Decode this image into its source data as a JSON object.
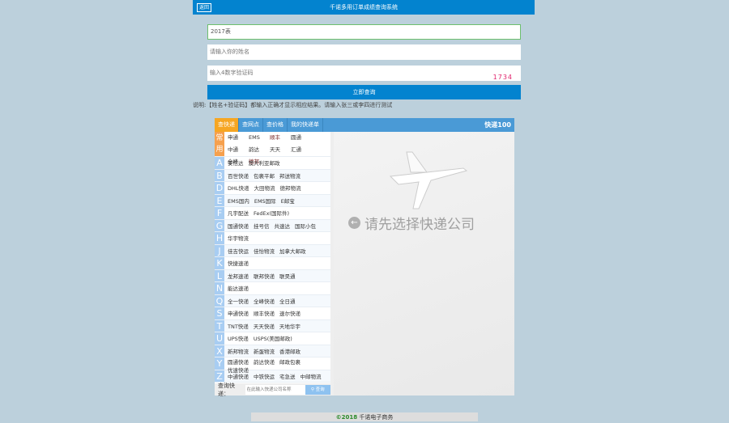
{
  "header": {
    "title": "千诺多用订单成绩查询系统",
    "back_label": "返回"
  },
  "form": {
    "year_value": "2017表",
    "name_placeholder": "请输入你的姓名",
    "code_placeholder": "输入4数字验证码",
    "captcha": "1734",
    "submit_label": "立即查询"
  },
  "note": "说明:【姓名+验证码】都输入正确才显示相应结果。请输入张三或李四进行测试",
  "widget": {
    "tabs": [
      "查快递",
      "查网点",
      "查价格",
      "我的快递单"
    ],
    "logo": "快递100",
    "common_label": "常用",
    "common": [
      "申通",
      "EMS",
      "顺丰",
      "圆通",
      "中通",
      "韵达",
      "天天",
      "汇通",
      "全峰",
      "德邦"
    ],
    "groups": [
      {
        "letter": "A",
        "items": [
          "安信达",
          "澳大利亚邮政"
        ]
      },
      {
        "letter": "B",
        "items": [
          "百世快递",
          "包裹平邮",
          "邦送物流"
        ]
      },
      {
        "letter": "D",
        "items": [
          "DHL快递",
          "大田物流",
          "德邦物流"
        ]
      },
      {
        "letter": "E",
        "items": [
          "EMS国内",
          "EMS国际",
          "E邮宝"
        ]
      },
      {
        "letter": "F",
        "items": [
          "凡宇配送",
          "FedEx(国际件)"
        ]
      },
      {
        "letter": "G",
        "items": [
          "国通快递",
          "挂号信",
          "共速达",
          "国际小包"
        ]
      },
      {
        "letter": "H",
        "items": [
          "华宇物流"
        ]
      },
      {
        "letter": "J",
        "items": [
          "佳吉快运",
          "佳怡物流",
          "加拿大邮政"
        ]
      },
      {
        "letter": "K",
        "items": [
          "快捷速递"
        ]
      },
      {
        "letter": "L",
        "items": [
          "龙邦速递",
          "联邦快递",
          "联昊通"
        ]
      },
      {
        "letter": "N",
        "items": [
          "能达速递"
        ]
      },
      {
        "letter": "Q",
        "items": [
          "全一快递",
          "全峰快递",
          "全日通"
        ]
      },
      {
        "letter": "S",
        "items": [
          "申通快递",
          "顺丰快递",
          "速尔快递"
        ]
      },
      {
        "letter": "T",
        "items": [
          "TNT快递",
          "天天快递",
          "天地华宇"
        ]
      },
      {
        "letter": "U",
        "items": [
          "UPS快递",
          "USPS(美国邮政)"
        ]
      },
      {
        "letter": "X",
        "items": [
          "新邦物流",
          "新蛋物流",
          "香港邮政"
        ]
      },
      {
        "letter": "Y",
        "items": [
          "圆通快递",
          "韵达快递",
          "邮政包裹",
          "优速快递"
        ]
      },
      {
        "letter": "Z",
        "items": [
          "中通快递",
          "中铁快运",
          "宅急送",
          "中邮物流"
        ]
      }
    ],
    "search_label": "查询快递：",
    "search_placeholder": "在此输入快递公司名称",
    "search_button": "查询",
    "prompt": "请先选择快递公司"
  },
  "footer": {
    "year": "©2018",
    "company": "千诺电子商务"
  }
}
